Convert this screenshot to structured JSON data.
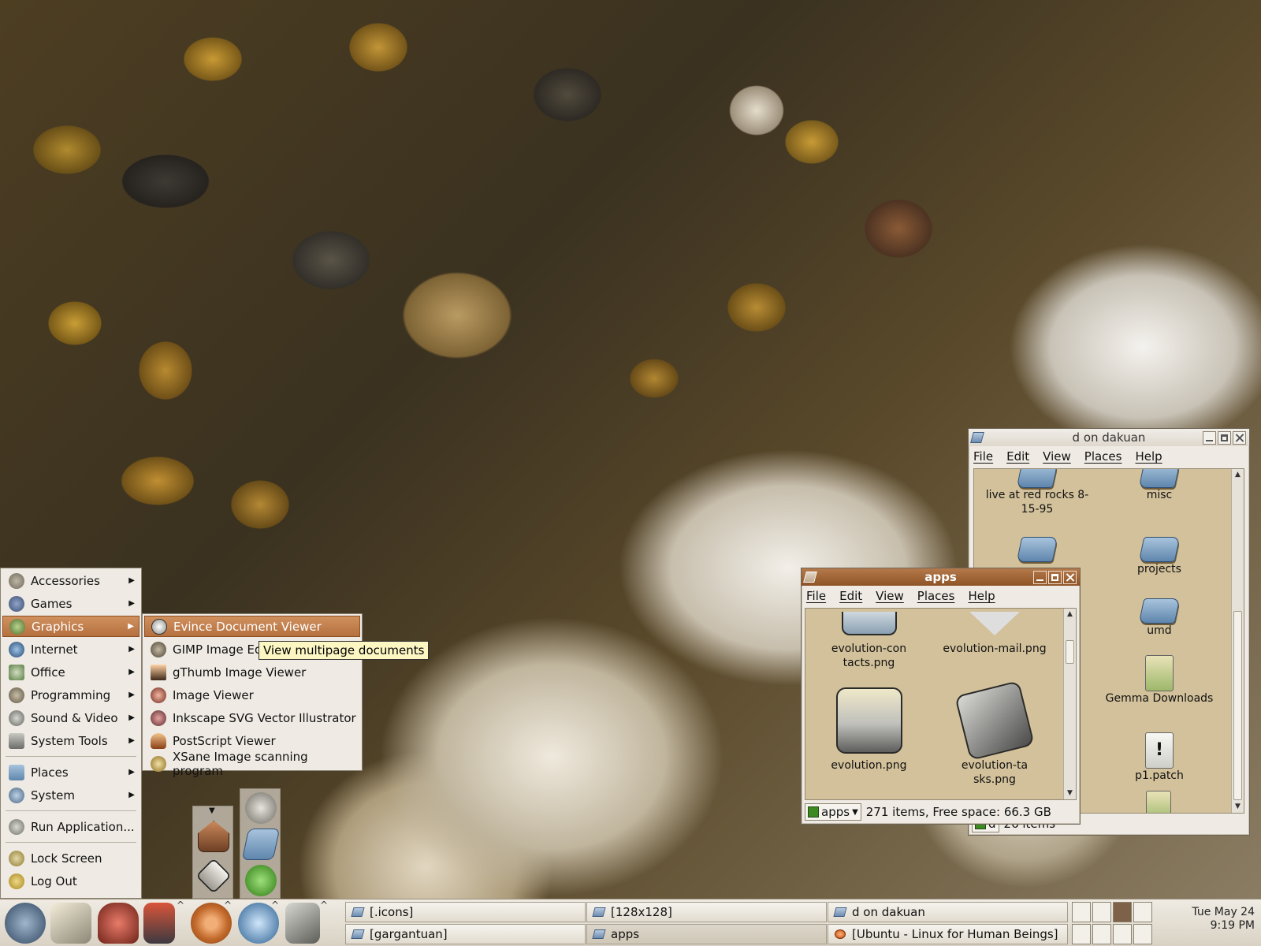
{
  "colors": {
    "menu_highlight": "#c0804c",
    "window_bg": "#efebe4",
    "file_pane_bg": "#d2c19a",
    "tooltip_bg": "#fbf6c2",
    "active_titlebar": "#a56a3a"
  },
  "main_menu": {
    "items": [
      {
        "label": "Accessories",
        "icon": "accessories-icon"
      },
      {
        "label": "Games",
        "icon": "games-icon"
      },
      {
        "label": "Graphics",
        "icon": "graphics-icon"
      },
      {
        "label": "Internet",
        "icon": "internet-icon"
      },
      {
        "label": "Office",
        "icon": "office-icon"
      },
      {
        "label": "Programming",
        "icon": "programming-icon"
      },
      {
        "label": "Sound & Video",
        "icon": "sound-video-icon"
      },
      {
        "label": "System Tools",
        "icon": "system-tools-icon"
      },
      {
        "label": "Places",
        "icon": "places-icon"
      },
      {
        "label": "System",
        "icon": "system-icon"
      },
      {
        "label": "Run Application...",
        "icon": "run-application-icon"
      },
      {
        "label": "Lock Screen",
        "icon": "lock-screen-icon"
      },
      {
        "label": "Log Out",
        "icon": "log-out-icon"
      }
    ],
    "selected": "Graphics"
  },
  "graphics_submenu": {
    "items": [
      {
        "label": "Evince Document Viewer",
        "icon": "evince-icon"
      },
      {
        "label": "GIMP Image Ed",
        "icon": "gimp-icon"
      },
      {
        "label": "gThumb Image Viewer",
        "icon": "gthumb-icon"
      },
      {
        "label": "Image Viewer",
        "icon": "image-viewer-icon"
      },
      {
        "label": "Inkscape SVG Vector Illustrator",
        "icon": "inkscape-icon"
      },
      {
        "label": "PostScript Viewer",
        "icon": "postscript-icon"
      },
      {
        "label": "XSane Image scanning program",
        "icon": "xsane-icon"
      }
    ],
    "selected": "Evince Document Viewer"
  },
  "tooltip": {
    "text": "View multipage documents"
  },
  "window_dakuan": {
    "title": "d on dakuan",
    "menu": [
      "File",
      "Edit",
      "View",
      "Places",
      "Help"
    ],
    "items": [
      {
        "label": "live at red rocks 8-15-95",
        "icon": "folder-icon"
      },
      {
        "label": "misc",
        "icon": "folder-icon"
      },
      {
        "label": "",
        "icon": "folder-icon"
      },
      {
        "label": "projects",
        "icon": "folder-icon"
      },
      {
        "label": "umd",
        "icon": "folder-icon"
      },
      {
        "label": "Gemma Downloads",
        "icon": "downloads-icon"
      },
      {
        "label": "p1.patch",
        "icon": "patch-file-icon"
      }
    ],
    "status_location": "d",
    "status_text": "26 items"
  },
  "window_apps": {
    "title": "apps",
    "menu": [
      "File",
      "Edit",
      "View",
      "Places",
      "Help"
    ],
    "items": [
      {
        "label": "evolution-contacts.png",
        "icon": "evolution-contacts-icon"
      },
      {
        "label": "evolution-mail.png",
        "icon": "evolution-mail-icon"
      },
      {
        "label": "evolution.png",
        "icon": "evolution-icon"
      },
      {
        "label": "evolution-tasks.png",
        "icon": "evolution-tasks-icon"
      }
    ],
    "location": "apps",
    "status_text": "271 items, Free space: 66.3 GB"
  },
  "panel": {
    "launchers": [
      {
        "name": "gnome-foot-icon"
      },
      {
        "name": "mail-icon"
      },
      {
        "name": "jar-icon"
      },
      {
        "name": "joystick-icon"
      },
      {
        "name": "gear-icon"
      },
      {
        "name": "globe-icon"
      },
      {
        "name": "terminal-icon"
      }
    ],
    "tasks": [
      {
        "label": "[.icons]"
      },
      {
        "label": "[128x128]"
      },
      {
        "label": "d on dakuan"
      },
      {
        "label": "[gargantuan]"
      },
      {
        "label": "apps"
      },
      {
        "label": "[Ubuntu - Linux for Human Beings]"
      }
    ],
    "clock_date": "Tue May 24",
    "clock_time": "9:19 PM"
  }
}
